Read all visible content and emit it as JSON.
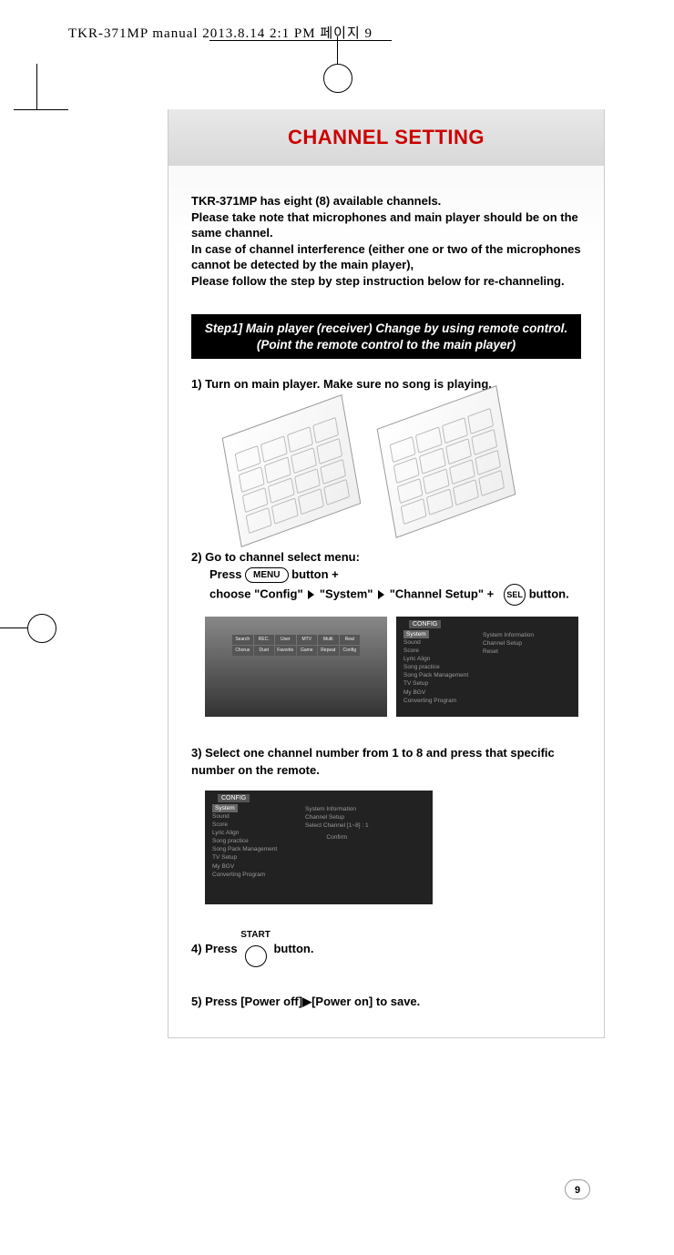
{
  "header": {
    "filename": "TKR-371MP manual  2013.8.14  2:1 PM  페이지 9"
  },
  "title": "CHANNEL SETTING",
  "intro": {
    "line1": "TKR-371MP has eight (8) available channels.",
    "line2": "Please take note that microphones and main player should be on the same channel.",
    "line3": "In case of channel interference (either one or two of the microphones cannot be detected by the main player),",
    "line4": "Please follow the step by step instruction below for re-channeling."
  },
  "step_header": {
    "line1": "Step1]  Main player (receiver) Change by using remote control.",
    "line2": "(Point the remote control to the main player)"
  },
  "steps": {
    "s1": "1) Turn on main player. Make sure no song is playing.",
    "s2_a": "2) Go to channel select menu:",
    "s2_b": "Press",
    "s2_c": "button +",
    "s2_d": "choose \"Config\"",
    "s2_e": "\"System\"",
    "s2_f": "\"Channel Setup\" +",
    "s2_g": "button.",
    "s3": "3) Select one channel number from 1 to 8 and press that specific number on the remote.",
    "s4_a": "4) Press",
    "s4_b": "button.",
    "s5": "5) Press [Power off]▶[Power on] to save."
  },
  "buttons": {
    "menu": "MENU",
    "sel": "SEL",
    "start": "START"
  },
  "menu_grid": [
    "Search",
    "REC.",
    "User",
    "MTV",
    "Multi",
    "Real",
    "Chorus",
    "Duet",
    "Favorite",
    "Game",
    "Repeat",
    "Config"
  ],
  "config_panel": {
    "title": "CONFIG",
    "items": [
      "System",
      "Sound",
      "Score",
      "Lyric Align",
      "Song practice",
      "Song Pack Management",
      "TV Setup",
      "My BGV",
      "Converting Program"
    ],
    "right_items": [
      "System Information",
      "Channel Setup",
      "Reset"
    ],
    "channel_select": "Select Channel [1~8] : 1",
    "confirm": "Confirm"
  },
  "page_number": "9"
}
